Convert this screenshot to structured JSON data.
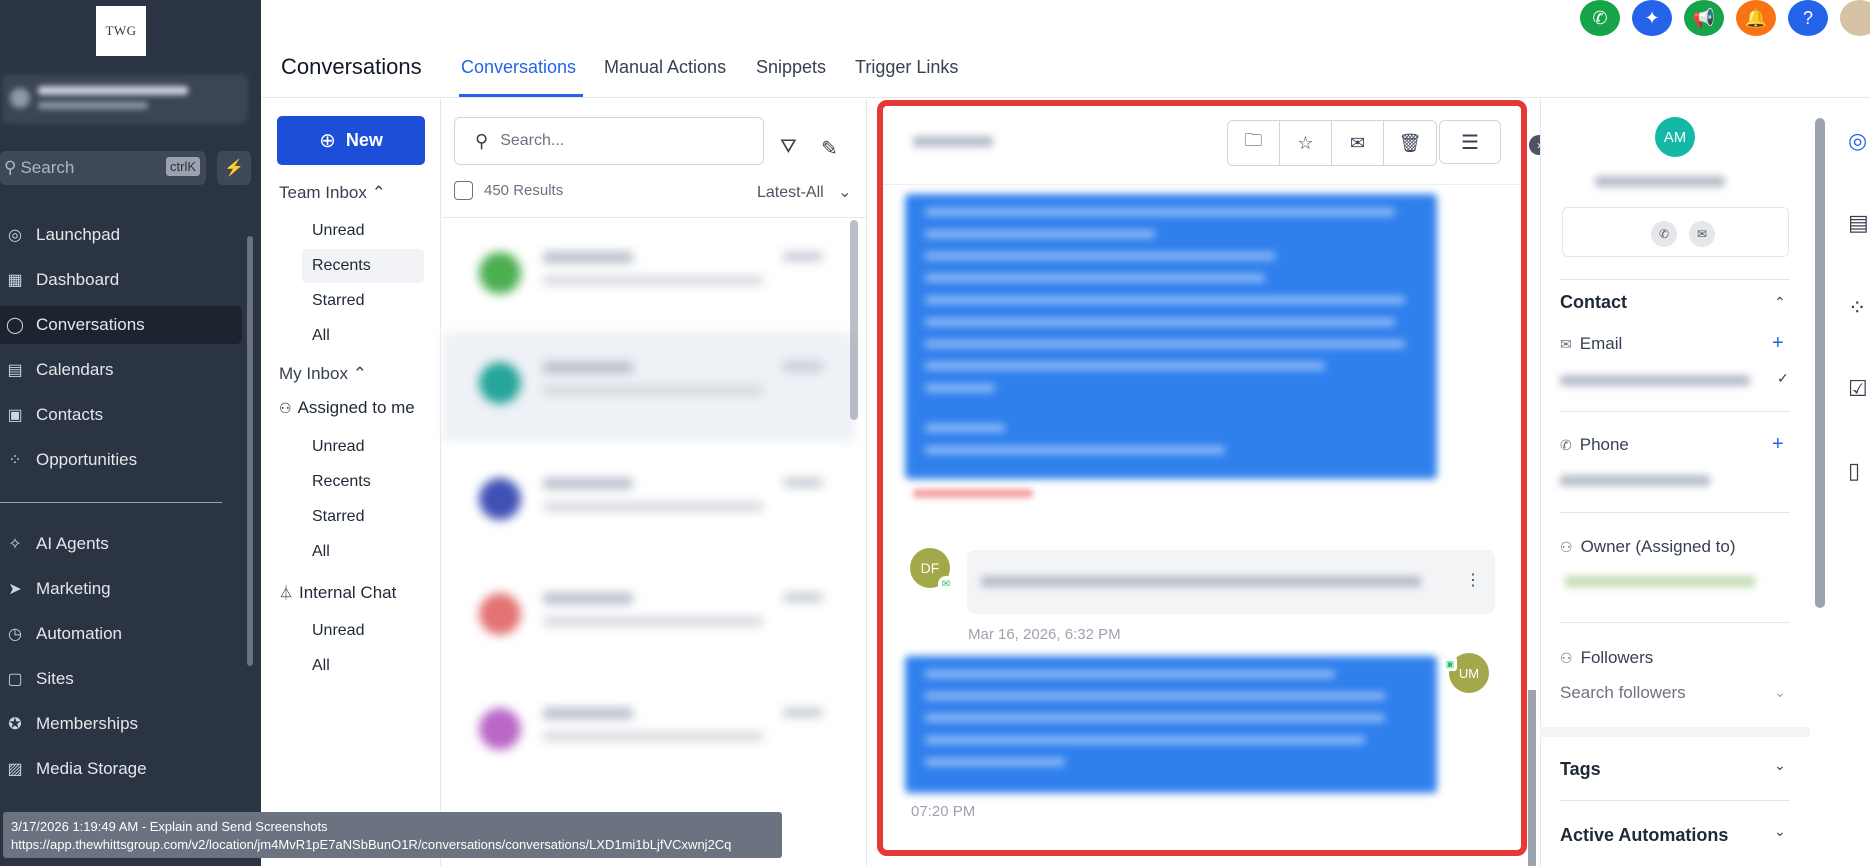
{
  "sidebar": {
    "logo_text": "TWG",
    "search_placeholder": "Search",
    "search_shortcut": "ctrlK",
    "nav": [
      {
        "label": "Launchpad",
        "icon": "launchpad-icon",
        "glyph": "◎"
      },
      {
        "label": "Dashboard",
        "icon": "dashboard-icon",
        "glyph": "▦"
      },
      {
        "label": "Conversations",
        "icon": "chat-icon",
        "glyph": "◯"
      },
      {
        "label": "Calendars",
        "icon": "calendar-icon",
        "glyph": "▤"
      },
      {
        "label": "Contacts",
        "icon": "contacts-icon",
        "glyph": "▣"
      },
      {
        "label": "Opportunities",
        "icon": "opportunities-icon",
        "glyph": "⁘"
      },
      {
        "label": "AI Agents",
        "icon": "sparkle-icon",
        "glyph": "✧"
      },
      {
        "label": "Marketing",
        "icon": "send-icon",
        "glyph": "➤"
      },
      {
        "label": "Automation",
        "icon": "automation-icon",
        "glyph": "◷"
      },
      {
        "label": "Sites",
        "icon": "sites-icon",
        "glyph": "▢"
      },
      {
        "label": "Memberships",
        "icon": "membership-icon",
        "glyph": "✪"
      },
      {
        "label": "Media Storage",
        "icon": "media-icon",
        "glyph": "▨"
      }
    ]
  },
  "header": {
    "title": "Conversations",
    "tabs": [
      "Conversations",
      "Manual Actions",
      "Snippets",
      "Trigger Links"
    ]
  },
  "inbox": {
    "new_label": "New",
    "team_inbox": "Team Inbox",
    "team_items": [
      "Unread",
      "Recents",
      "Starred",
      "All"
    ],
    "my_inbox": "My Inbox",
    "assigned": "Assigned to me",
    "my_items": [
      "Unread",
      "Recents",
      "Starred",
      "All"
    ],
    "internal_chat": "Internal Chat",
    "internal_items": [
      "Unread",
      "All"
    ]
  },
  "list": {
    "search_placeholder": "Search...",
    "results": "450 Results",
    "sort": "Latest-All"
  },
  "chat": {
    "sender_initials": "DF",
    "review_time": "Mar 16, 2026, 6:32 PM",
    "user_initials": "UM",
    "reply_time": "07:20 PM"
  },
  "contact_panel": {
    "initials": "AM",
    "contact_heading": "Contact",
    "email_label": "Email",
    "phone_label": "Phone",
    "owner_label": "Owner (Assigned to)",
    "followers_label": "Followers",
    "followers_placeholder": "Search followers",
    "tags_heading": "Tags",
    "automations_heading": "Active Automations"
  },
  "status_tooltip": {
    "line1": "3/17/2026 1:19:49 AM - Explain and Send Screenshots",
    "line2": "https://app.thewhittsgroup.com/v2/location/jm4MvR1pE7aNSbBunO1R/conversations/conversations/LXD1mi1bLjfVCxwnj2Cq"
  },
  "colors": {
    "sidebar_bg": "#2b3443",
    "accent": "#2563eb",
    "highlight_border": "#e53935",
    "bubble": "#2f80ed"
  }
}
